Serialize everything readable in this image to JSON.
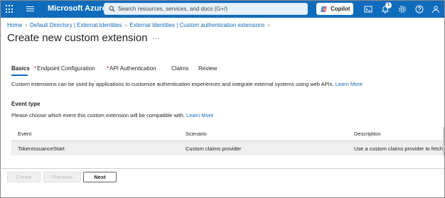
{
  "topbar": {
    "brand": "Microsoft Azure",
    "search_placeholder": "Search resources, services, and docs (G+/)",
    "copilot_label": "Copilot",
    "notification_count": "1",
    "icons": [
      "waffle-icon",
      "menu-icon",
      "search-icon",
      "terminal-icon",
      "bell-icon",
      "settings-icon",
      "help-icon",
      "feedback-icon"
    ],
    "accent": "#0f6cbd"
  },
  "breadcrumb": {
    "items": [
      "Home",
      "Default Directory | External Identities",
      "External Identities | Custom authentication extensions"
    ]
  },
  "page": {
    "title": "Create new custom extension",
    "more_label": "..."
  },
  "tabs": [
    {
      "label": "Basics",
      "required": false,
      "active": true
    },
    {
      "label": "Endpoint Configuration",
      "required": true,
      "active": false
    },
    {
      "label": "API Authentication",
      "required": true,
      "active": false
    },
    {
      "label": "Claims",
      "required": false,
      "active": false
    },
    {
      "label": "Review",
      "required": false,
      "active": false
    }
  ],
  "required_mark": "*",
  "description": {
    "text": "Custom extensions can be used by applications to customize authentication experiences and integrate external systems using web APIs.",
    "link": "Learn More"
  },
  "event_type": {
    "title": "Event type",
    "hint": "Please choose which event this custom extension will be compatible with.",
    "hint_link": "Learn More",
    "columns": [
      "Event",
      "Scenario",
      "Description"
    ],
    "rows": [
      [
        "TokenIssuanceStart",
        "Custom claims provider",
        "Use a custom claims provider to fetch"
      ]
    ]
  },
  "footer": {
    "create_label": "Create",
    "previous_label": "Previous",
    "next_label": "Next"
  }
}
